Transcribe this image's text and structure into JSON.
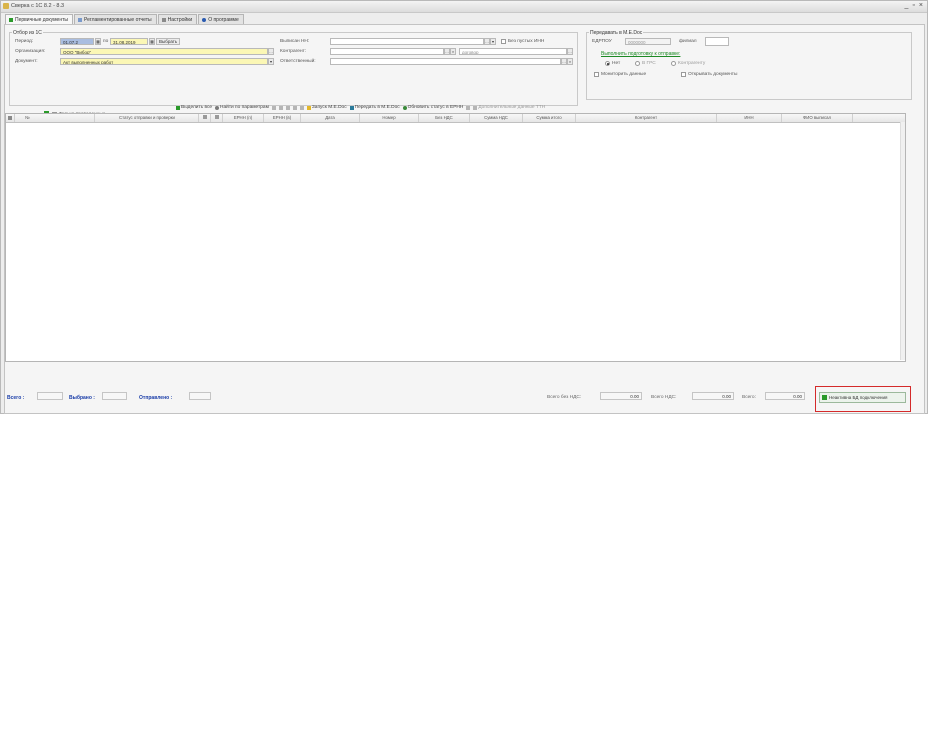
{
  "window": {
    "title": "Сверка с 1С 8.2 - 8.3",
    "controls": [
      "_",
      "▫",
      "×"
    ]
  },
  "tabs": [
    {
      "label": "Первичные документы",
      "active": true
    },
    {
      "label": "Регламентированные отчеты",
      "active": false
    },
    {
      "label": "Настройки",
      "active": false
    },
    {
      "label": "О программе",
      "active": false
    }
  ],
  "selection": {
    "legend": "Отбор из 1С",
    "period_label": "Период:",
    "period_from": "01.07.2",
    "period_to_label": "по",
    "period_to": "31.08.2019",
    "choose_button": "Выбрать",
    "organization_label": "Организация:",
    "organization_value": "ООО \"Вибор\"",
    "document_label": "Документ:",
    "document_value": "Акт выполненных работ",
    "owner_inn_label": "Выписан НН:",
    "owner_inn_value": "",
    "empty_inn_label": "Без пустых ИНН",
    "counterparty_label": "Контрагент:",
    "counterparty_value": "",
    "contract_label": "договор",
    "responsible_label": "Ответственный:",
    "responsible_value": ""
  },
  "transfer": {
    "legend": "Передавать в М.Е.Doc",
    "edrpou_label": "ЕДРПОУ",
    "edrpou_value": "0000000",
    "filial_label": "филиал",
    "filial_value": "",
    "prepare_link": "Выполнить подготовку к отправке:",
    "radio_options": [
      {
        "label": "Нет",
        "checked": true
      },
      {
        "label": "В ГРС",
        "checked": false
      },
      {
        "label": "Контрагенту",
        "checked": false
      }
    ],
    "monitor_label": "Мониторить данные",
    "show_docs_label": "Открывать документы"
  },
  "only_posted_label": "Только проведенные",
  "toolbar": {
    "items": [
      {
        "label": "Выделить все",
        "disabled": false,
        "icon": "check-icon",
        "color": "#2a9a2a"
      },
      {
        "label": "Найти по параметрам",
        "disabled": false,
        "icon": "search-icon",
        "color": "#7a7a7a"
      },
      {
        "label": "",
        "disabled": true,
        "icon": "cut-icon",
        "color": "#999999"
      },
      {
        "label": "",
        "disabled": true,
        "icon": "sort-asc-icon",
        "color": "#999999"
      },
      {
        "label": "",
        "disabled": true,
        "icon": "sort-desc-icon",
        "color": "#999999"
      },
      {
        "label": "",
        "disabled": true,
        "icon": "filter-icon",
        "color": "#999999"
      },
      {
        "label": "",
        "disabled": true,
        "icon": "copy-icon",
        "color": "#999999"
      },
      {
        "label": "Запуск М.Е.Doc",
        "disabled": false,
        "icon": "launch-icon",
        "color": "#e3b72a"
      },
      {
        "label": "Передать в М.Е.Doc",
        "disabled": false,
        "icon": "send-icon",
        "color": "#2a7a9a"
      },
      {
        "label": "Обновить статус в ЕРНН",
        "disabled": false,
        "icon": "refresh-icon",
        "color": "#3a8a3a"
      },
      {
        "label": "",
        "disabled": true,
        "icon": "print-icon",
        "color": "#999999"
      },
      {
        "label": "Дополнительные данные ТТН",
        "disabled": true,
        "icon": "pencil-icon",
        "color": "#999999"
      }
    ]
  },
  "grid": {
    "columns": [
      "№",
      "Статус отправки и проверки",
      "",
      "",
      "ЕРНН (п)",
      "ЕРНН (в)",
      "Дата",
      "Номер",
      "Без НДС",
      "Сумма НДС",
      "Сумма итого",
      "Контрагент",
      "ИНН",
      "ФИО выписал"
    ],
    "rows": []
  },
  "footer": {
    "total_label": "Всего :",
    "total_value": "",
    "selected_label": "Выбрано :",
    "selected_value": "",
    "sent_label": "Отправлено :",
    "sent_value": "",
    "without_vat_label": "Всего без НДС:",
    "without_vat_value": "0.00",
    "vat_label": "Всего НДС:",
    "vat_value": "0.00",
    "sum_label": "Всего:",
    "sum_value": "0.00",
    "db_button": "Неактивна БД подключения"
  }
}
